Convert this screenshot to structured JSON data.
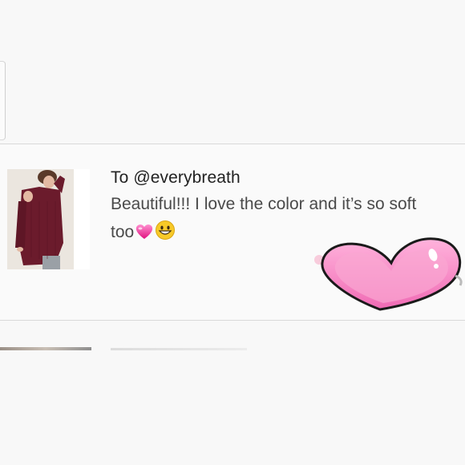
{
  "review": {
    "recipient": "To @everybreath",
    "text_line1": "Beautiful!!! I love the color and it’s so soft",
    "text_line2": "too",
    "emojis": [
      "pink-heart-sparkle-emoji",
      "grinning-face-emoji"
    ]
  },
  "stickers": [
    "pink-heart-sticker"
  ],
  "colors": {
    "background": "#f8f8f8",
    "divider": "#d9d9d9",
    "sweater": "#6b1b2c",
    "heart_pink": "#f48fc8",
    "heart_outline": "#1a1a1a"
  }
}
